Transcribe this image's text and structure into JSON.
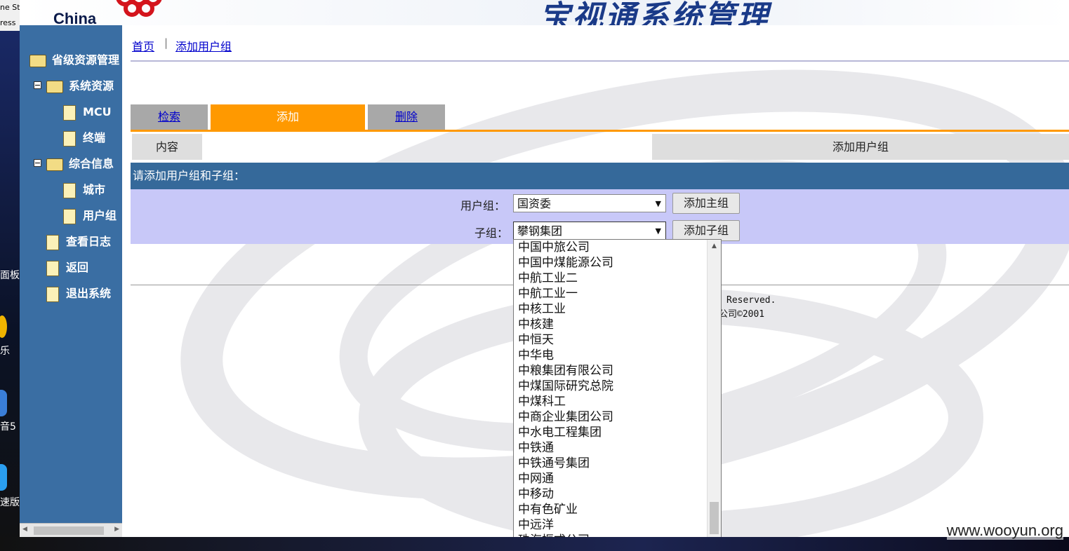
{
  "desktop": {
    "top_fragment": "ne St",
    "second_fragment": "ress",
    "labels": [
      "面板",
      "乐",
      "音5",
      "速版"
    ]
  },
  "header": {
    "logo_text": "China",
    "system_title": "宝视通系统管理"
  },
  "sidebar": {
    "items": [
      {
        "label": "省级资源管理",
        "kind": "folder"
      },
      {
        "label": "系统资源",
        "kind": "folder"
      },
      {
        "label": "MCU",
        "kind": "doc"
      },
      {
        "label": "终端",
        "kind": "doc"
      },
      {
        "label": "综合信息",
        "kind": "folder"
      },
      {
        "label": "城市",
        "kind": "doc"
      },
      {
        "label": "用户组",
        "kind": "doc"
      },
      {
        "label": "查看日志",
        "kind": "doc"
      },
      {
        "label": "返回",
        "kind": "doc"
      },
      {
        "label": "退出系统",
        "kind": "doc"
      }
    ]
  },
  "breadcrumb": {
    "home": "首页",
    "separator": "|",
    "current": "添加用户组"
  },
  "tabs": {
    "search": "检索",
    "add": "添加",
    "delete": "删除"
  },
  "content_row": {
    "left": "内容",
    "right": "添加用户组"
  },
  "section_title": "请添加用户组和子组：",
  "form": {
    "group_label": "用户组：",
    "group_value": "国资委",
    "add_group_button": "添加主组",
    "subgroup_label": "子组：",
    "subgroup_value": "攀钢集团",
    "add_subgroup_button": "添加子组"
  },
  "footer": {
    "line1": "Reserved.",
    "line2": "公司©2001"
  },
  "dropdown_options": [
    "中国中旅公司",
    "中国中煤能源公司",
    "中航工业二",
    "中航工业一",
    "中核工业",
    "中核建",
    "中恒天",
    "中华电",
    "中粮集团有限公司",
    "中煤国际研究总院",
    "中煤科工",
    "中商企业集团公司",
    "中水电工程集团",
    "中铁通",
    "中铁通号集团",
    "中网通",
    "中移动",
    "中有色矿业",
    "中远洋",
    "珠海振戎公司"
  ],
  "watermark": "www.wooyun.org",
  "colors": {
    "sidebar": "#3a6ea3",
    "tab_active": "#ff9900",
    "section_bar": "#35699a",
    "form_bg": "#c8c8f8"
  }
}
